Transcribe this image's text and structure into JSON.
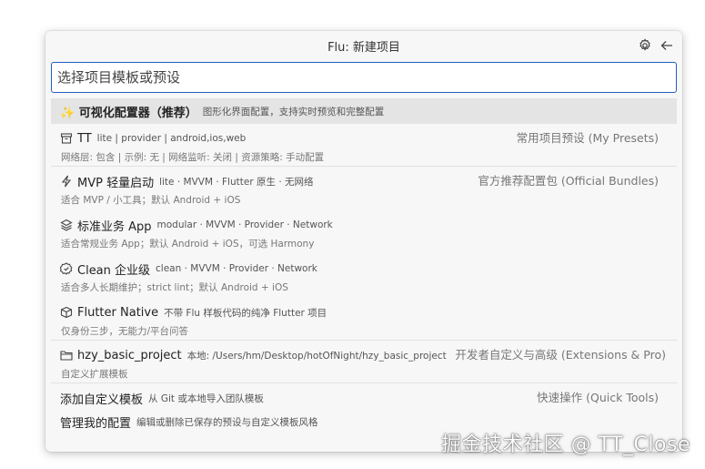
{
  "window": {
    "title": "Flu: 新建项目"
  },
  "search": {
    "placeholder": "选择项目模板或预设"
  },
  "highlight": {
    "icon": "sparkles-icon",
    "label": "✨ 可视化配置器（推荐）",
    "desc": "图形化界面配置，支持实时预览和完整配置"
  },
  "items": [
    {
      "icon": "archive-icon",
      "label": "TT",
      "desc": "lite | provider | android,ios,web",
      "sub": "网络层: 包含 | 示例: 无 | 网络监听: 关闭 | 资源策略: 手动配置",
      "category": "常用项目预设 (My Presets)"
    },
    {
      "icon": "zap-icon",
      "label": "MVP 轻量启动",
      "desc": "lite · MVVM · Flutter 原生 · 无网络",
      "sub": "适合 MVP / 小工具；默认 Android + iOS",
      "category": "官方推荐配置包 (Official Bundles)"
    },
    {
      "icon": "layers-icon",
      "label": "标准业务 App",
      "desc": "modular · MVVM · Provider · Network",
      "sub": "适合常规业务 App；默认 Android + iOS，可选 Harmony"
    },
    {
      "icon": "verified-icon",
      "label": "Clean 企业级",
      "desc": "clean · MVVM · Provider · Network",
      "sub": "适合多人长期维护；strict lint；默认 Android + iOS"
    },
    {
      "icon": "package-icon",
      "label": "Flutter Native",
      "desc": "不带 Flu 样板代码的纯净 Flutter 项目",
      "sub": "仅身份三步，无能力/平台问答"
    },
    {
      "icon": "folder-icon",
      "label": "hzy_basic_project",
      "desc": "本地: /Users/hm/Desktop/hotOfNight/hzy_basic_project",
      "sub": "自定义扩展模板",
      "category": "开发者自定义与高级 (Extensions & Pro)"
    },
    {
      "label": "添加自定义模板",
      "desc": "从 Git 或本地导入团队模板",
      "category": "快速操作 (Quick Tools)"
    },
    {
      "label": "管理我的配置",
      "desc": "编辑或删除已保存的预设与自定义模板风格"
    }
  ],
  "watermark": "掘金技术社区 @ TT_Close"
}
